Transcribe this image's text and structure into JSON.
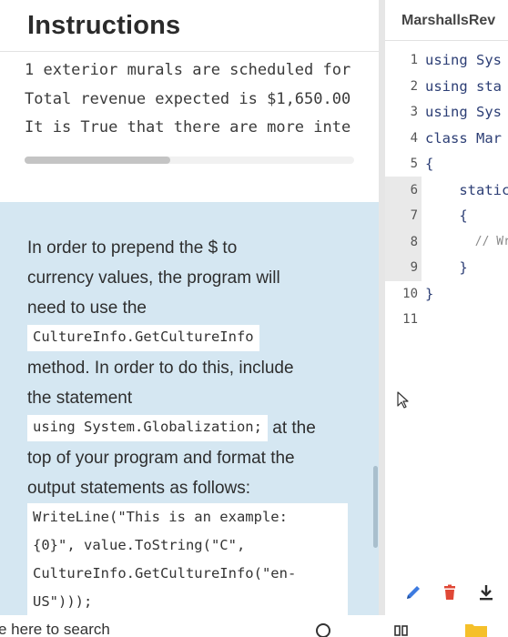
{
  "instructions": {
    "title": "Instructions",
    "output_lines": [
      "1 exterior murals are scheduled for",
      "Total revenue expected is $1,650.00",
      "It is True that there are more inte"
    ],
    "note": {
      "line1": "In order to prepend the $ to",
      "line2": "currency values, the program will",
      "line3": "need to use the",
      "chip1": "CultureInfo.GetCultureInfo",
      "line4": "method. In order to do this, include",
      "line5": "the statement",
      "chip2": "using System.Globalization;",
      "line6_tail": " at the",
      "line7": "top of your program and format the",
      "line8": "output statements as follows:",
      "code_lines": [
        "WriteLine(\"This is an example:",
        "{0}\", value.ToString(\"C\",",
        "CultureInfo.GetCultureInfo(\"en-",
        "US\")));"
      ]
    }
  },
  "editor": {
    "file_name": "MarshallsRev",
    "line_numbers": [
      "1",
      "2",
      "3",
      "4",
      "5",
      "6",
      "7",
      "8",
      "9",
      "10",
      "11"
    ],
    "code_lines": [
      "using Sys",
      "using sta",
      "using Sys",
      "class Mar",
      "{",
      "    static",
      "    {",
      "       // Wr",
      "    }",
      "}",
      ""
    ],
    "toolbar_icons": [
      "pencil-icon",
      "trash-icon",
      "download-icon"
    ]
  },
  "bottom": {
    "search_placeholder": "e here to search"
  },
  "colors": {
    "note_bg": "#d5e7f2",
    "pencil": "#3d7be0",
    "trash": "#e04836"
  }
}
